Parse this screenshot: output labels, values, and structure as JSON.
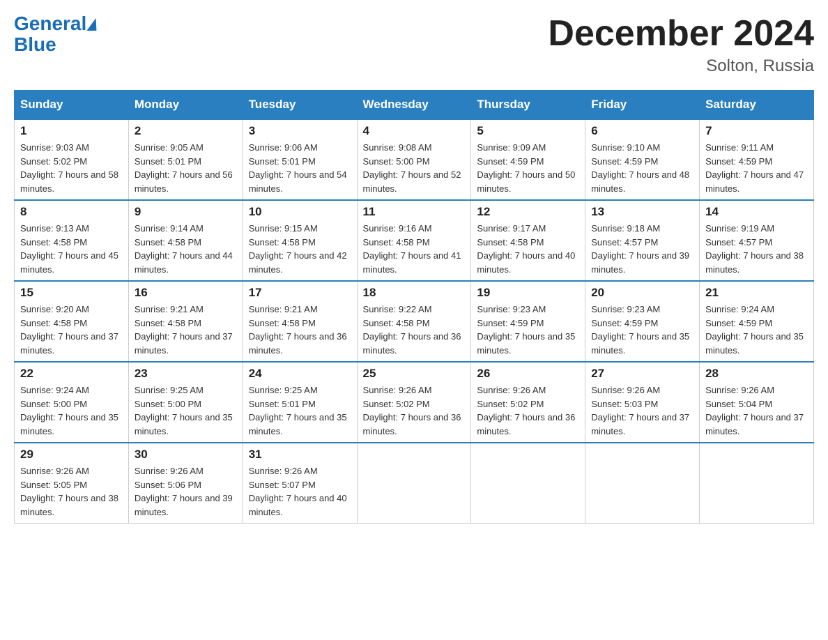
{
  "header": {
    "logo_general": "General",
    "logo_blue": "Blue",
    "title": "December 2024",
    "subtitle": "Solton, Russia"
  },
  "days_of_week": [
    "Sunday",
    "Monday",
    "Tuesday",
    "Wednesday",
    "Thursday",
    "Friday",
    "Saturday"
  ],
  "weeks": [
    [
      {
        "day": "1",
        "sunrise": "9:03 AM",
        "sunset": "5:02 PM",
        "daylight": "7 hours and 58 minutes."
      },
      {
        "day": "2",
        "sunrise": "9:05 AM",
        "sunset": "5:01 PM",
        "daylight": "7 hours and 56 minutes."
      },
      {
        "day": "3",
        "sunrise": "9:06 AM",
        "sunset": "5:01 PM",
        "daylight": "7 hours and 54 minutes."
      },
      {
        "day": "4",
        "sunrise": "9:08 AM",
        "sunset": "5:00 PM",
        "daylight": "7 hours and 52 minutes."
      },
      {
        "day": "5",
        "sunrise": "9:09 AM",
        "sunset": "4:59 PM",
        "daylight": "7 hours and 50 minutes."
      },
      {
        "day": "6",
        "sunrise": "9:10 AM",
        "sunset": "4:59 PM",
        "daylight": "7 hours and 48 minutes."
      },
      {
        "day": "7",
        "sunrise": "9:11 AM",
        "sunset": "4:59 PM",
        "daylight": "7 hours and 47 minutes."
      }
    ],
    [
      {
        "day": "8",
        "sunrise": "9:13 AM",
        "sunset": "4:58 PM",
        "daylight": "7 hours and 45 minutes."
      },
      {
        "day": "9",
        "sunrise": "9:14 AM",
        "sunset": "4:58 PM",
        "daylight": "7 hours and 44 minutes."
      },
      {
        "day": "10",
        "sunrise": "9:15 AM",
        "sunset": "4:58 PM",
        "daylight": "7 hours and 42 minutes."
      },
      {
        "day": "11",
        "sunrise": "9:16 AM",
        "sunset": "4:58 PM",
        "daylight": "7 hours and 41 minutes."
      },
      {
        "day": "12",
        "sunrise": "9:17 AM",
        "sunset": "4:58 PM",
        "daylight": "7 hours and 40 minutes."
      },
      {
        "day": "13",
        "sunrise": "9:18 AM",
        "sunset": "4:57 PM",
        "daylight": "7 hours and 39 minutes."
      },
      {
        "day": "14",
        "sunrise": "9:19 AM",
        "sunset": "4:57 PM",
        "daylight": "7 hours and 38 minutes."
      }
    ],
    [
      {
        "day": "15",
        "sunrise": "9:20 AM",
        "sunset": "4:58 PM",
        "daylight": "7 hours and 37 minutes."
      },
      {
        "day": "16",
        "sunrise": "9:21 AM",
        "sunset": "4:58 PM",
        "daylight": "7 hours and 37 minutes."
      },
      {
        "day": "17",
        "sunrise": "9:21 AM",
        "sunset": "4:58 PM",
        "daylight": "7 hours and 36 minutes."
      },
      {
        "day": "18",
        "sunrise": "9:22 AM",
        "sunset": "4:58 PM",
        "daylight": "7 hours and 36 minutes."
      },
      {
        "day": "19",
        "sunrise": "9:23 AM",
        "sunset": "4:59 PM",
        "daylight": "7 hours and 35 minutes."
      },
      {
        "day": "20",
        "sunrise": "9:23 AM",
        "sunset": "4:59 PM",
        "daylight": "7 hours and 35 minutes."
      },
      {
        "day": "21",
        "sunrise": "9:24 AM",
        "sunset": "4:59 PM",
        "daylight": "7 hours and 35 minutes."
      }
    ],
    [
      {
        "day": "22",
        "sunrise": "9:24 AM",
        "sunset": "5:00 PM",
        "daylight": "7 hours and 35 minutes."
      },
      {
        "day": "23",
        "sunrise": "9:25 AM",
        "sunset": "5:00 PM",
        "daylight": "7 hours and 35 minutes."
      },
      {
        "day": "24",
        "sunrise": "9:25 AM",
        "sunset": "5:01 PM",
        "daylight": "7 hours and 35 minutes."
      },
      {
        "day": "25",
        "sunrise": "9:26 AM",
        "sunset": "5:02 PM",
        "daylight": "7 hours and 36 minutes."
      },
      {
        "day": "26",
        "sunrise": "9:26 AM",
        "sunset": "5:02 PM",
        "daylight": "7 hours and 36 minutes."
      },
      {
        "day": "27",
        "sunrise": "9:26 AM",
        "sunset": "5:03 PM",
        "daylight": "7 hours and 37 minutes."
      },
      {
        "day": "28",
        "sunrise": "9:26 AM",
        "sunset": "5:04 PM",
        "daylight": "7 hours and 37 minutes."
      }
    ],
    [
      {
        "day": "29",
        "sunrise": "9:26 AM",
        "sunset": "5:05 PM",
        "daylight": "7 hours and 38 minutes."
      },
      {
        "day": "30",
        "sunrise": "9:26 AM",
        "sunset": "5:06 PM",
        "daylight": "7 hours and 39 minutes."
      },
      {
        "day": "31",
        "sunrise": "9:26 AM",
        "sunset": "5:07 PM",
        "daylight": "7 hours and 40 minutes."
      },
      null,
      null,
      null,
      null
    ]
  ]
}
